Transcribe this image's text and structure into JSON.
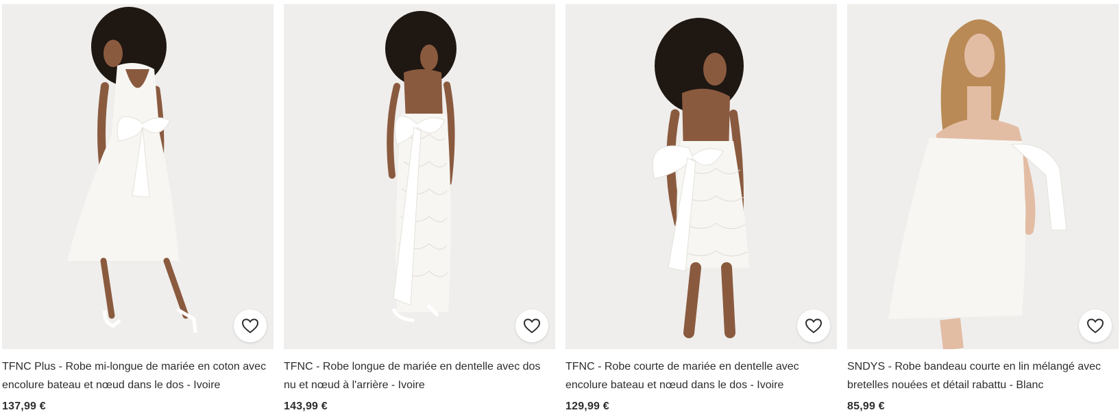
{
  "products": [
    {
      "title": "TFNC Plus - Robe mi-longue de mariée en coton avec encolure bateau et nœud dans le dos - Ivoire",
      "price": "137,99 €",
      "image_alt": "Femme portant une robe mi-longue blanche avec nœud dans le dos",
      "favorite_icon": "heart-icon"
    },
    {
      "title": "TFNC - Robe longue de mariée en dentelle avec dos nu et nœud à l'arrière - Ivoire",
      "price": "143,99 €",
      "image_alt": "Femme portant une robe longue en dentelle blanche dos nu",
      "favorite_icon": "heart-icon"
    },
    {
      "title": "TFNC - Robe courte de mariée en dentelle avec encolure bateau et nœud dans le dos - Ivoire",
      "price": "129,99 €",
      "image_alt": "Femme portant une robe courte en dentelle blanche avec nœud",
      "favorite_icon": "heart-icon"
    },
    {
      "title": "SNDYS - Robe bandeau courte en lin mélangé avec bretelles nouées et détail rabattu - Blanc",
      "price": "85,99 €",
      "image_alt": "Femme portant une robe bandeau courte blanche",
      "favorite_icon": "heart-icon"
    }
  ],
  "colors": {
    "text": "#2d2d2d",
    "image_bg": "#efeeec",
    "dress": "#f7f6f2",
    "hair_dark": "#1f1712",
    "hair_blonde": "#b98a55",
    "skin_dark": "#8a5a3f",
    "skin_light": "#e3bca4"
  }
}
